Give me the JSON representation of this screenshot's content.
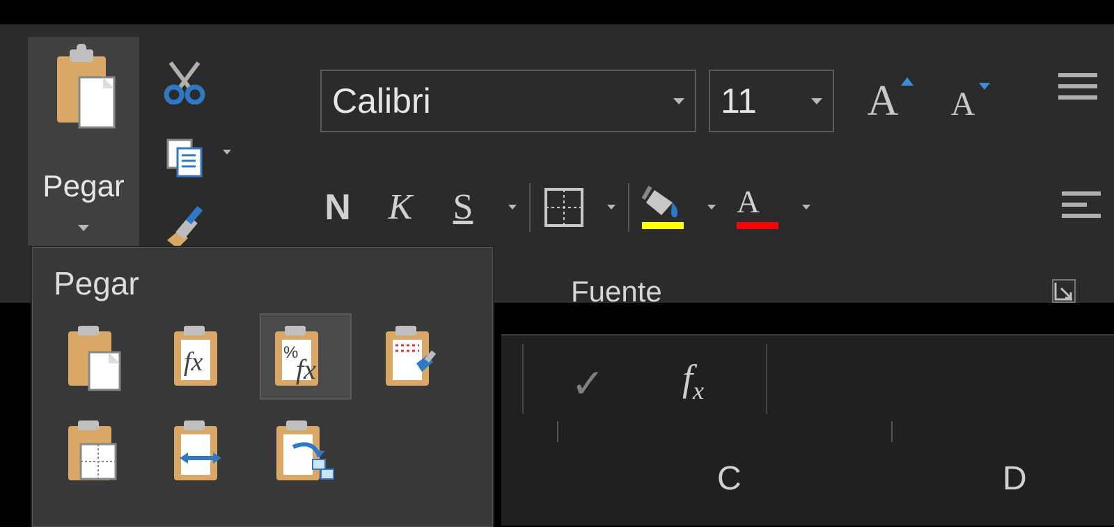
{
  "clipboard": {
    "paste_label": "Pegar"
  },
  "font": {
    "name": "Calibri",
    "size": "11",
    "group_label": "Fuente",
    "bold": "N",
    "italic": "K",
    "underline": "S",
    "fill_color": "#ffff00",
    "font_color": "#ff0000"
  },
  "paste_menu": {
    "title": "Pegar"
  },
  "columns": {
    "c": "C",
    "d": "D"
  }
}
